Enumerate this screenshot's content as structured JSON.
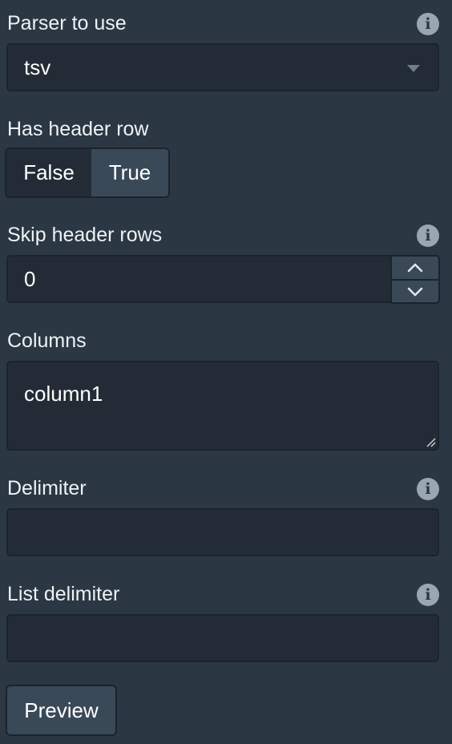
{
  "parser": {
    "label": "Parser to use",
    "info_icon": "info-icon",
    "info_glyph": "i",
    "selected": "tsv"
  },
  "header_row": {
    "label": "Has header row",
    "options": [
      "False",
      "True"
    ],
    "selected": "True"
  },
  "skip_rows": {
    "label": "Skip header rows",
    "info_glyph": "i",
    "value": "0"
  },
  "columns": {
    "label": "Columns",
    "value": "column1"
  },
  "delimiter": {
    "label": "Delimiter",
    "info_glyph": "i",
    "value": ""
  },
  "list_delimiter": {
    "label": "List delimiter",
    "info_glyph": "i",
    "value": ""
  },
  "preview_button": {
    "label": "Preview"
  },
  "colors": {
    "background": "#2b3743",
    "field": "#232c36",
    "button": "#3a4958",
    "info_icon": "#9aa6b2"
  }
}
